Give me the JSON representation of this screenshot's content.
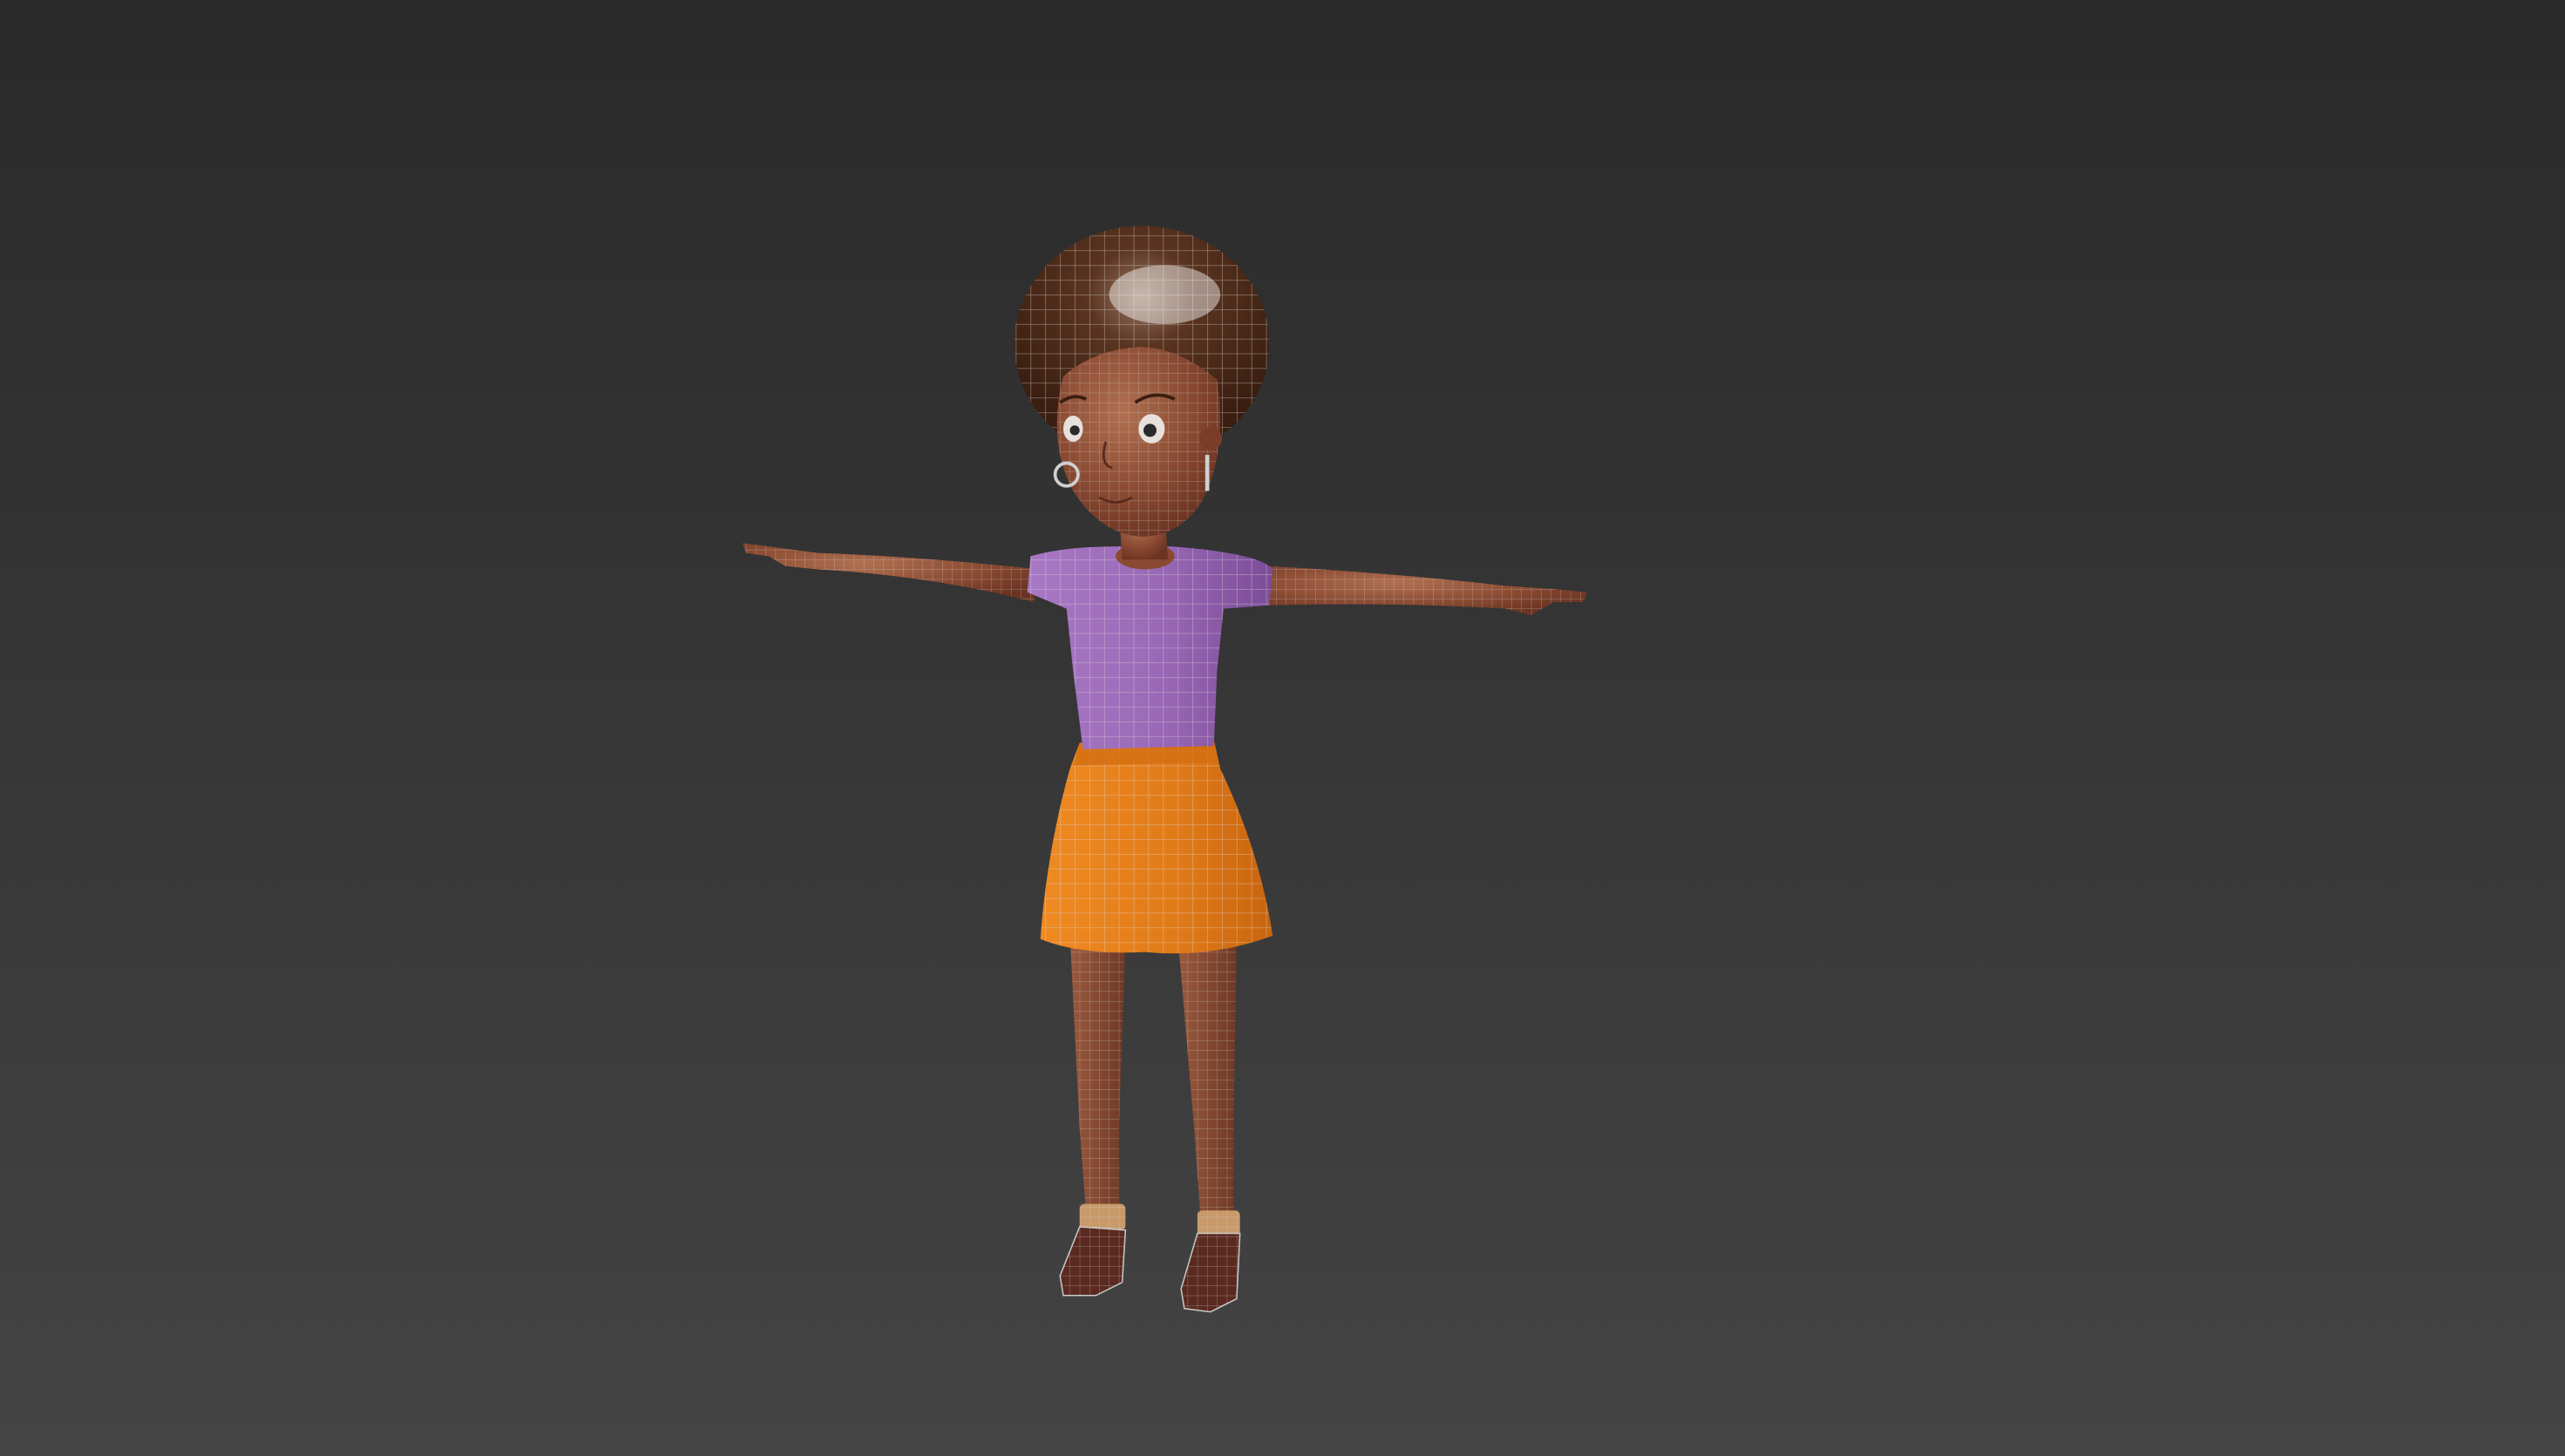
{
  "viewport": {
    "shading": "smooth-highlights-with-edged-faces",
    "background_top": "#2a2a2a",
    "background_bottom": "#444444"
  },
  "model": {
    "pose": "T-pose",
    "colors": {
      "skin": "#8a4a32",
      "hair": "#4a2a18",
      "shirt": "#9b6ab8",
      "skirt": "#e07a18",
      "socks": "#c89a6a",
      "shoes": "#5a2a20",
      "wireframe": "#c9c9c9"
    }
  }
}
